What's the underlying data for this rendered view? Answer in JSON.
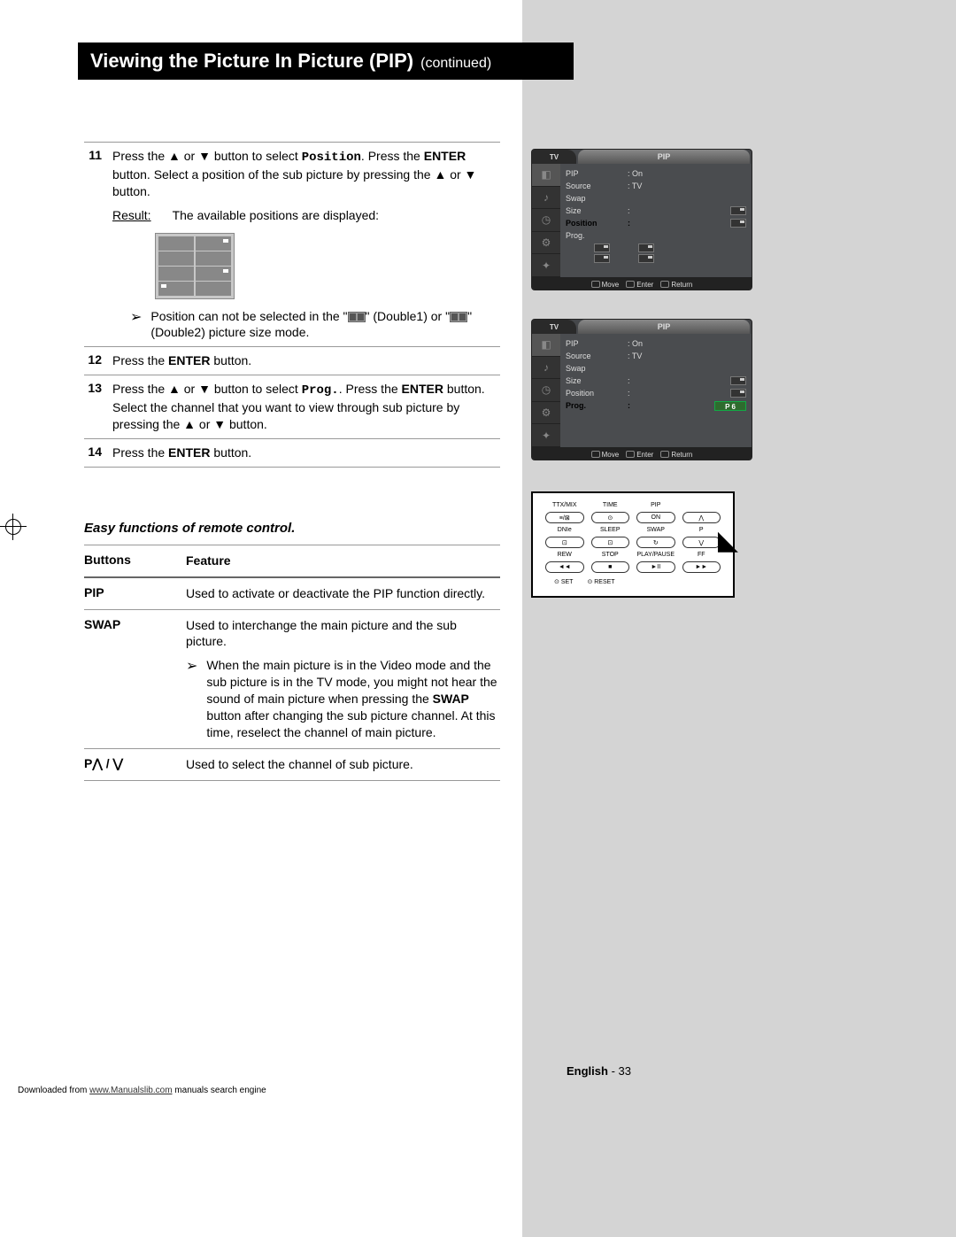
{
  "title": {
    "main": "Viewing the Picture In Picture (PIP)",
    "continued": "(continued)"
  },
  "steps": [
    {
      "num": "11",
      "text_parts": [
        "Press the ▲ or ▼ button to select ",
        "Position",
        ". Press the ",
        "ENTER",
        " button. Select a position of the sub picture by pressing the ▲ or ▼ button."
      ],
      "result_label": "Result:",
      "result_text": "The available positions are displayed:",
      "note_parts": [
        "Position can not be selected in the \"",
        "\" (Double1) or \"",
        "\" (Double2) picture size mode."
      ]
    },
    {
      "num": "12",
      "text_parts": [
        "Press the ",
        "ENTER",
        " button."
      ]
    },
    {
      "num": "13",
      "text_parts": [
        "Press the ▲ or ▼ button to select ",
        "Prog.",
        ". Press the ",
        "ENTER",
        " button. Select the channel that you want to view through sub picture by pressing the ▲ or ▼ button."
      ]
    },
    {
      "num": "14",
      "text_parts": [
        "Press the ",
        "ENTER",
        " button."
      ]
    }
  ],
  "easy_heading": "Easy functions of remote control.",
  "feature_table": {
    "header": {
      "col1": "Buttons",
      "col2": "Feature"
    },
    "rows": [
      {
        "button": "PIP",
        "feature": "Used to activate or deactivate the PIP function directly."
      },
      {
        "button": "SWAP",
        "feature": "Used to interchange the main picture and the sub picture.",
        "note_parts": [
          "When the main picture is in the Video mode and the sub picture is in the TV mode, you might not hear the sound of main picture when pressing the ",
          "SWAP",
          " button after changing the sub picture channel. At this time, reselect the channel of main picture."
        ]
      },
      {
        "button": "P⋀ / ⋁",
        "feature": "Used to select the channel of sub picture."
      }
    ]
  },
  "osd": {
    "tab": "TV",
    "title": "PIP",
    "items": [
      {
        "label": "PIP",
        "value": ": On"
      },
      {
        "label": "Source",
        "value": ": TV"
      },
      {
        "label": "Swap",
        "value": ""
      },
      {
        "label": "Size",
        "value": ":"
      },
      {
        "label": "Position",
        "value": ":"
      },
      {
        "label": "Prog.",
        "value": ":"
      }
    ],
    "highlight1": "Position",
    "highlight2": "Prog.",
    "prog_value": "P 6",
    "footer": {
      "move": "Move",
      "enter": "Enter",
      "return": "Return"
    }
  },
  "remote": {
    "row1_labels": [
      "TTX/MIX",
      "TIME",
      "PIP",
      ""
    ],
    "row1_btns": [
      "≡/⊠",
      "⊙",
      "ON",
      "⋀"
    ],
    "row2_labels": [
      "DNIe",
      "SLEEP",
      "SWAP",
      "P"
    ],
    "row2_btns": [
      "⊡",
      "⊡",
      "↻",
      "⋁"
    ],
    "row3_labels": [
      "REW",
      "STOP",
      "PLAY/PAUSE",
      "FF"
    ],
    "row3_btns": [
      "◄◄",
      "■",
      "►II",
      "►►"
    ],
    "foot": [
      "SET",
      "RESET"
    ]
  },
  "footer": {
    "lang": "English",
    "page": "33"
  },
  "download": {
    "prefix": "Downloaded from ",
    "link": "www.Manualslib.com",
    "suffix": " manuals search engine"
  }
}
